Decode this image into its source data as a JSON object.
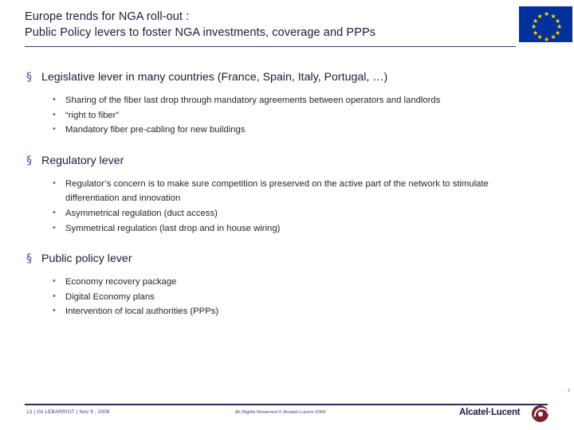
{
  "header": {
    "title_line1": "Europe trends for NGA roll-out :",
    "title_line2": "Public Policy levers to foster NGA investments, coverage and PPPs",
    "flag_name": "european-union-flag"
  },
  "content": {
    "blocks": [
      {
        "heading": "Legislative lever in many countries (France, Spain, Italy, Portugal, …)",
        "bullets": [
          "Sharing of the fiber last drop through mandatory agreements between operators and landlords",
          "“right to fiber”",
          "Mandatory fiber pre-cabling for new buildings"
        ]
      },
      {
        "heading": "Regulatory lever",
        "bullets": [
          "Regulator’s concern is to make sure competition is preserved on the active part of the network to stimulate differentiation and innovation",
          "Asymmetrical regulation (duct access)",
          "Symmetrical regulation (last drop and in house wiring)"
        ]
      },
      {
        "heading": "Public policy lever",
        "bullets": [
          "Economy recovery package",
          "Digital Economy plans",
          "Intervention of local authorities (PPPs)"
        ]
      }
    ],
    "level1_marker": "§",
    "level2_marker": "•"
  },
  "footer": {
    "left": "13 | Gil LEBARRIOT | Nov 9 , 2009",
    "center": "All Rights Reserved © Alcatel-Lucent 2009",
    "page_number": "3",
    "logo_text": "Alcatel·Lucent"
  }
}
